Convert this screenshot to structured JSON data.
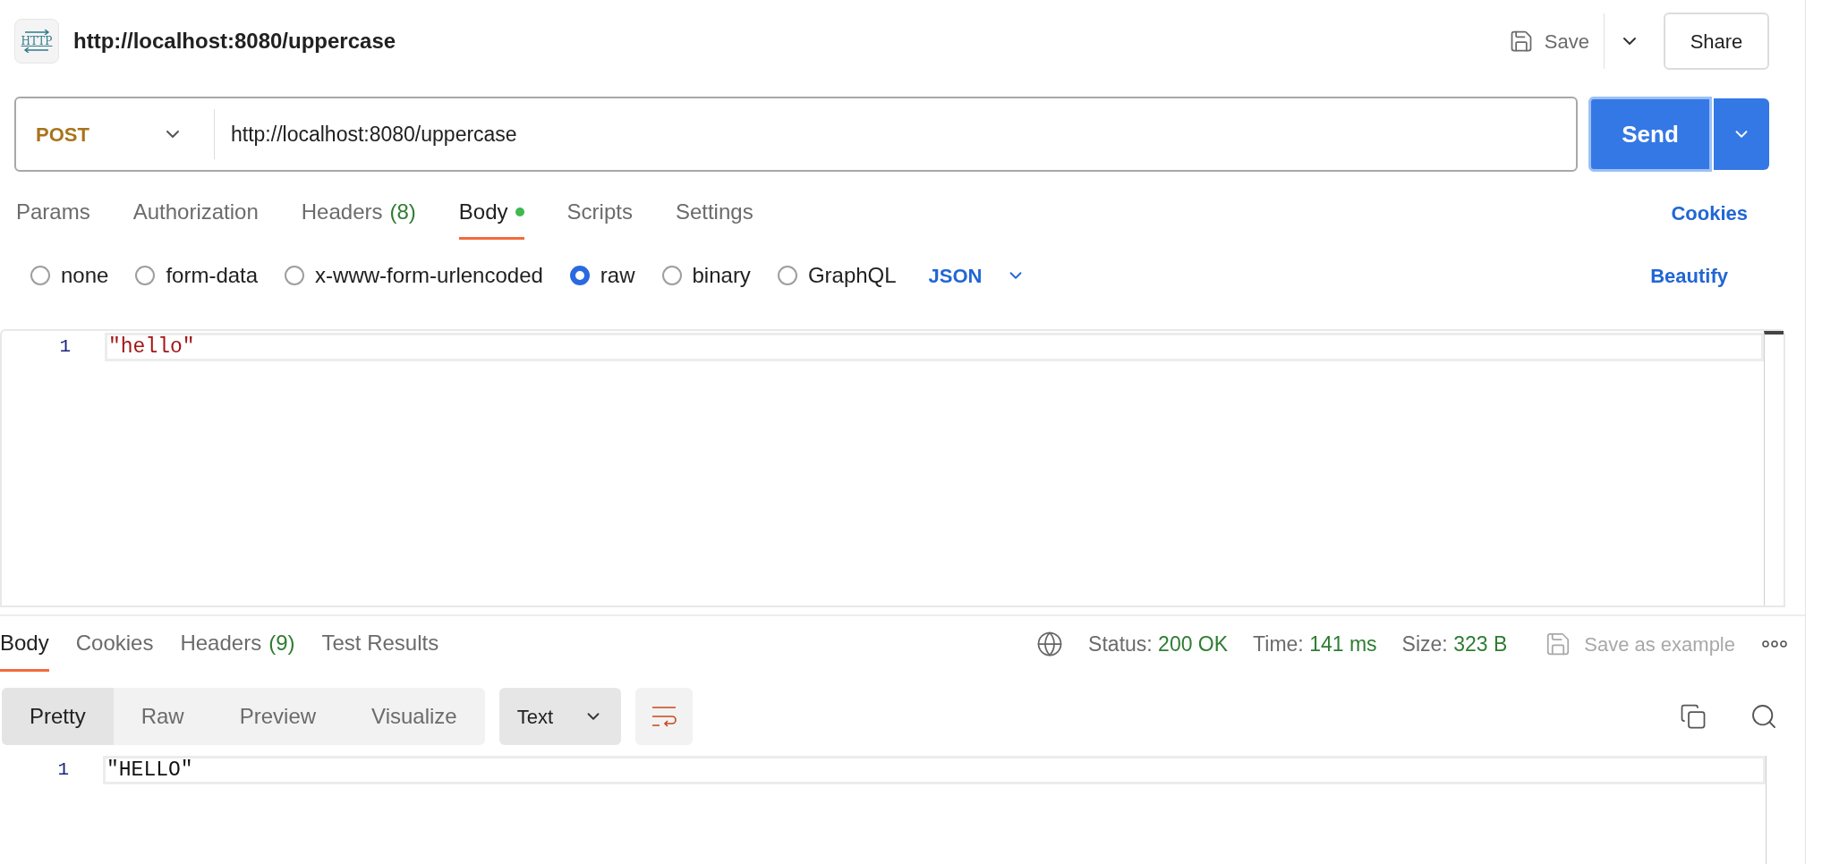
{
  "header": {
    "icon_label": "HTTP",
    "title": "http://localhost:8080/uppercase",
    "save": "Save",
    "share": "Share"
  },
  "request": {
    "method": "POST",
    "url": "http://localhost:8080/uppercase",
    "send": "Send"
  },
  "request_tabs": [
    {
      "label": "Params",
      "selected": false,
      "dot": false
    },
    {
      "label": "Authorization",
      "selected": false,
      "dot": false
    },
    {
      "label": "Headers",
      "count": "(8)",
      "selected": false,
      "dot": false
    },
    {
      "label": "Body",
      "selected": true,
      "dot": true
    },
    {
      "label": "Scripts",
      "selected": false,
      "dot": false
    },
    {
      "label": "Settings",
      "selected": false,
      "dot": false
    }
  ],
  "cookies_link": "Cookies",
  "body_types": [
    {
      "label": "none",
      "selected": false
    },
    {
      "label": "form-data",
      "selected": false
    },
    {
      "label": "x-www-form-urlencoded",
      "selected": false
    },
    {
      "label": "raw",
      "selected": true
    },
    {
      "label": "binary",
      "selected": false
    },
    {
      "label": "GraphQL",
      "selected": false
    }
  ],
  "language": "JSON",
  "beautify": "Beautify",
  "request_editor": {
    "lines": [
      {
        "number": "1",
        "text": "\"hello\""
      }
    ]
  },
  "response": {
    "tabs": [
      {
        "label": "Body",
        "selected": true
      },
      {
        "label": "Cookies",
        "selected": false
      },
      {
        "label": "Headers",
        "count": "(9)",
        "selected": false
      },
      {
        "label": "Test Results",
        "selected": false
      }
    ],
    "stats": [
      {
        "label": "Status:",
        "value": "200 OK"
      },
      {
        "label": "Time:",
        "value": "141 ms"
      },
      {
        "label": "Size:",
        "value": "323 B"
      }
    ],
    "save_as_example": {
      "label": "Save as example",
      "disabled": true
    },
    "view_modes": [
      {
        "label": "Pretty",
        "selected": true
      },
      {
        "label": "Raw",
        "selected": false
      },
      {
        "label": "Preview",
        "selected": false
      },
      {
        "label": "Visualize",
        "selected": false
      }
    ],
    "format": "Text",
    "lines": [
      {
        "number": "1",
        "text": "\"HELLO\""
      }
    ]
  }
}
